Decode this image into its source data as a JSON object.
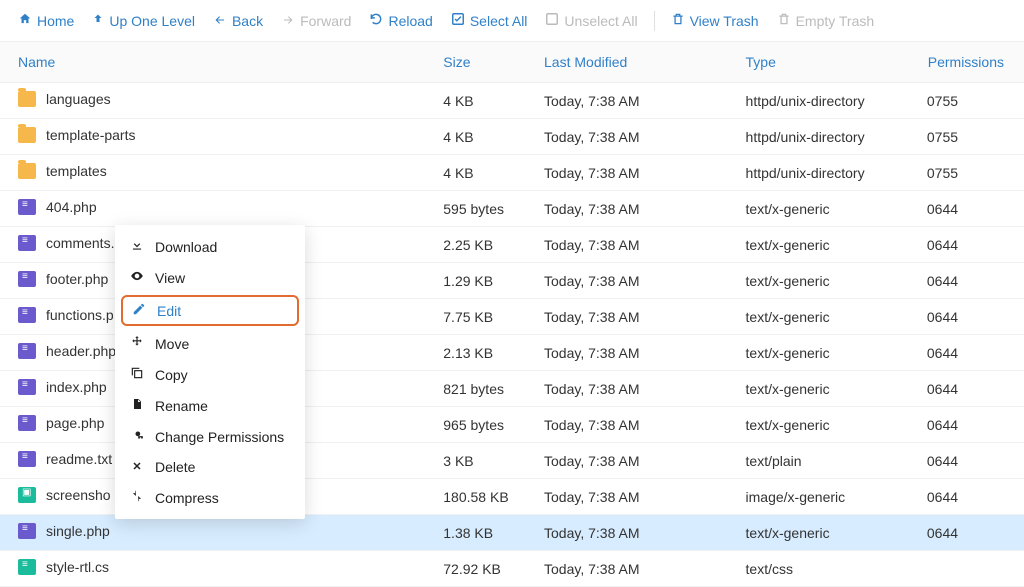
{
  "toolbar": {
    "home": "Home",
    "up": "Up One Level",
    "back": "Back",
    "forward": "Forward",
    "reload": "Reload",
    "selectAll": "Select All",
    "unselectAll": "Unselect All",
    "viewTrash": "View Trash",
    "emptyTrash": "Empty Trash"
  },
  "columns": {
    "name": "Name",
    "size": "Size",
    "modified": "Last Modified",
    "type": "Type",
    "permissions": "Permissions"
  },
  "rows": [
    {
      "icon": "folder",
      "name": "languages",
      "size": "4 KB",
      "modified": "Today, 7:38 AM",
      "type": "httpd/unix-directory",
      "perm": "0755"
    },
    {
      "icon": "folder",
      "name": "template-parts",
      "size": "4 KB",
      "modified": "Today, 7:38 AM",
      "type": "httpd/unix-directory",
      "perm": "0755"
    },
    {
      "icon": "folder",
      "name": "templates",
      "size": "4 KB",
      "modified": "Today, 7:38 AM",
      "type": "httpd/unix-directory",
      "perm": "0755"
    },
    {
      "icon": "code",
      "name": "404.php",
      "size": "595 bytes",
      "modified": "Today, 7:38 AM",
      "type": "text/x-generic",
      "perm": "0644"
    },
    {
      "icon": "code",
      "name": "comments.php",
      "size": "2.25 KB",
      "modified": "Today, 7:38 AM",
      "type": "text/x-generic",
      "perm": "0644"
    },
    {
      "icon": "code",
      "name": "footer.php",
      "size": "1.29 KB",
      "modified": "Today, 7:38 AM",
      "type": "text/x-generic",
      "perm": "0644"
    },
    {
      "icon": "code",
      "name": "functions.p",
      "size": "7.75 KB",
      "modified": "Today, 7:38 AM",
      "type": "text/x-generic",
      "perm": "0644"
    },
    {
      "icon": "code",
      "name": "header.php",
      "size": "2.13 KB",
      "modified": "Today, 7:38 AM",
      "type": "text/x-generic",
      "perm": "0644"
    },
    {
      "icon": "code",
      "name": "index.php",
      "size": "821 bytes",
      "modified": "Today, 7:38 AM",
      "type": "text/x-generic",
      "perm": "0644"
    },
    {
      "icon": "code",
      "name": "page.php",
      "size": "965 bytes",
      "modified": "Today, 7:38 AM",
      "type": "text/x-generic",
      "perm": "0644"
    },
    {
      "icon": "code",
      "name": "readme.txt",
      "size": "3 KB",
      "modified": "Today, 7:38 AM",
      "type": "text/plain",
      "perm": "0644"
    },
    {
      "icon": "img",
      "name": "screensho",
      "size": "180.58 KB",
      "modified": "Today, 7:38 AM",
      "type": "image/x-generic",
      "perm": "0644"
    },
    {
      "icon": "code",
      "name": "single.php",
      "size": "1.38 KB",
      "modified": "Today, 7:38 AM",
      "type": "text/x-generic",
      "perm": "0644",
      "selected": true
    },
    {
      "icon": "css",
      "name": "style-rtl.cs",
      "size": "72.92 KB",
      "modified": "Today, 7:38 AM",
      "type": "text/css",
      "perm": ""
    }
  ],
  "contextMenu": {
    "download": "Download",
    "view": "View",
    "edit": "Edit",
    "move": "Move",
    "copy": "Copy",
    "rename": "Rename",
    "changePerms": "Change Permissions",
    "delete": "Delete",
    "compress": "Compress"
  }
}
